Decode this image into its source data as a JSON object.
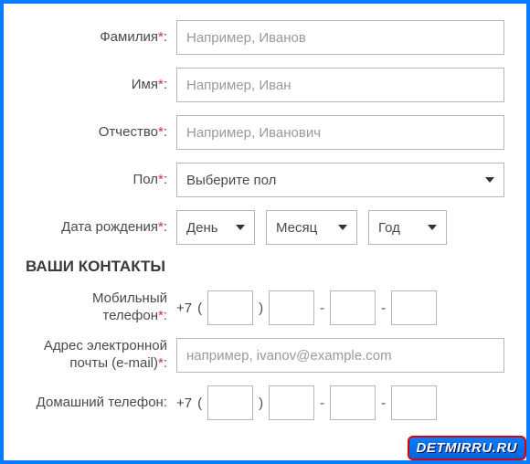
{
  "fields": {
    "lastname": {
      "label": "Фамилия",
      "placeholder": "Например, Иванов",
      "required": true
    },
    "firstname": {
      "label": "Имя",
      "placeholder": "Например, Иван",
      "required": true
    },
    "patronymic": {
      "label": "Отчество",
      "placeholder": "Например, Иванович",
      "required": true
    },
    "gender": {
      "label": "Пол",
      "selected": "Выберите пол",
      "required": true
    },
    "dob": {
      "label": "Дата рождения",
      "day": "День",
      "month": "Месяц",
      "year": "Год",
      "required": true
    }
  },
  "contacts_title": "ВАШИ КОНТАКТЫ",
  "mobile": {
    "label_l1": "Мобильный",
    "label_l2": "телефон",
    "prefix": "+7",
    "required": true
  },
  "email": {
    "label_l1": "Адрес электронной",
    "label_l2": "почты (e-mail)",
    "placeholder": "например, ivanov@example.com",
    "required": true
  },
  "home": {
    "label": "Домашний телефон:",
    "prefix": "+7"
  },
  "punct": {
    "colon": ":",
    "star": "*",
    "lp": "(",
    "rp": ")",
    "dash": "-"
  },
  "watermark": "DETMIRRU.RU"
}
